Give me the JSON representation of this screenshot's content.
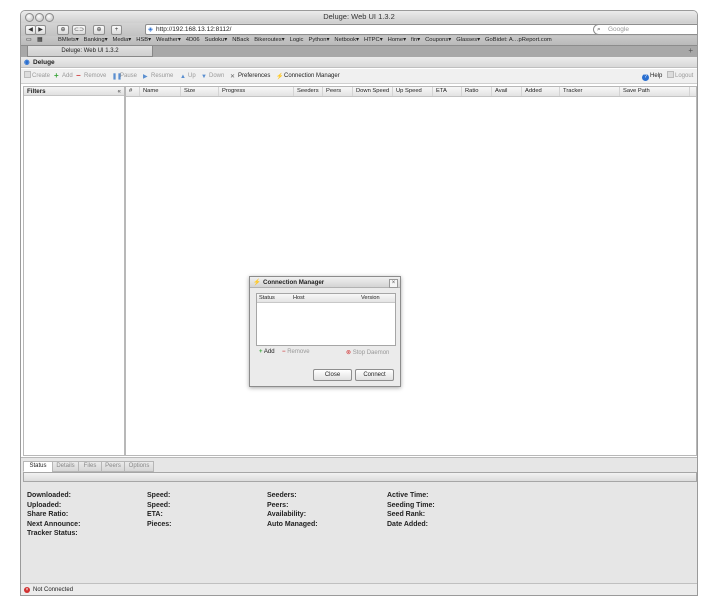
{
  "browser": {
    "window_title": "Deluge: Web UI 1.3.2",
    "url": "http://192.168.13.12:8112/",
    "search_placeholder": "Google",
    "nav_buttons": [
      "◀",
      "▶",
      "⊕",
      "⊂⊃",
      "⊕",
      "+"
    ],
    "bookmarks": [
      "BMlets▾",
      "Banking▾",
      "Media▾",
      "HSB▾",
      "Weather▾",
      "4D06",
      "Sudoku▾",
      "NBack",
      "Bikeroutes▾",
      "Logic",
      "Python▾",
      "Netbook▾",
      "HTPC▾",
      "Home▾",
      "fin▾",
      "Coupons▾",
      "Glasses▾",
      "GoBidet: A…pReport.com"
    ],
    "tab_label": "Deluge: Web UI 1.3.2",
    "new_tab": "+"
  },
  "app": {
    "title": "Deluge",
    "toolbar": {
      "create": "Create",
      "add": "Add",
      "remove": "Remove",
      "pause": "Pause",
      "resume": "Resume",
      "up": "Up",
      "down": "Down",
      "preferences": "Preferences",
      "connection_manager": "Connection Manager",
      "help": "Help",
      "logout": "Logout"
    },
    "filters": {
      "title": "Filters",
      "collapse": "«"
    },
    "columns": [
      "#",
      "Name",
      "Size",
      "Progress",
      "Seeders",
      "Peers",
      "Down Speed",
      "Up Speed",
      "ETA",
      "Ratio",
      "Avail",
      "Added",
      "Tracker",
      "Save Path"
    ],
    "bottom_tabs": [
      "Status",
      "Details",
      "Files",
      "Peers",
      "Options"
    ],
    "status_labels": {
      "col1": [
        "Downloaded:",
        "Uploaded:",
        "Share Ratio:",
        "Next Announce:",
        "Tracker Status:"
      ],
      "col2": [
        "Speed:",
        "Speed:",
        "ETA:",
        "Pieces:"
      ],
      "col3": [
        "Seeders:",
        "Peers:",
        "Availability:",
        "Auto Managed:"
      ],
      "col4": [
        "Active Time:",
        "Seeding Time:",
        "Seed Rank:",
        "Date Added:"
      ]
    },
    "statusbar": "Not Connected"
  },
  "dialog": {
    "title": "Connection Manager",
    "close": "×",
    "columns": [
      "Status",
      "Host",
      "Version"
    ],
    "add": "Add",
    "remove": "Remove",
    "stop_daemon": "Stop Daemon",
    "close_button": "Close",
    "connect_button": "Connect"
  },
  "colors": {
    "add_green": "#3aa53a",
    "remove_red": "#d04040",
    "error_red": "#d03030",
    "link_blue": "#2a6fd0"
  }
}
